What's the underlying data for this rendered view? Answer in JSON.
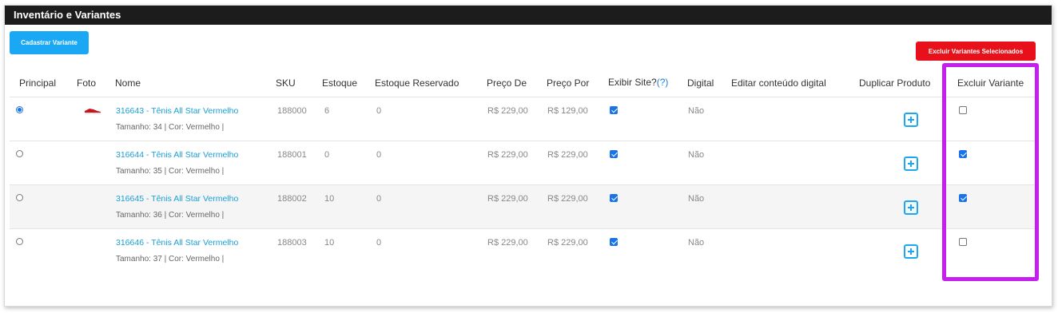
{
  "panel": {
    "title": "Inventário e Variantes"
  },
  "buttons": {
    "add_variant": "Cadastrar Variante",
    "delete_selected": "Excluir Variantes Selecionados"
  },
  "headers": {
    "principal": "Principal",
    "foto": "Foto",
    "nome": "Nome",
    "sku": "SKU",
    "estoque": "Estoque",
    "estoque_reservado": "Estoque Reservado",
    "preco_de": "Preço De",
    "preco_por": "Preço Por",
    "exibir_site": "Exibir Site?",
    "exibir_site_help": "(?)",
    "digital": "Digital",
    "editar_digital": "Editar conteúdo digital",
    "duplicar": "Duplicar Produto",
    "excluir": "Excluir Variante"
  },
  "rows": [
    {
      "principal": true,
      "has_photo": true,
      "name": "316643 - Tênis All Star Vermelho",
      "attrs": "Tamanho: 34 | Cor: Vermelho |",
      "sku": "188000",
      "estoque": "6",
      "reservado": "0",
      "preco_de": "R$ 229,00",
      "preco_por": "R$ 129,00",
      "exibir_site": true,
      "digital": "Não",
      "excluir": false
    },
    {
      "principal": false,
      "has_photo": false,
      "name": "316644 - Tênis All Star Vermelho",
      "attrs": "Tamanho: 35 | Cor: Vermelho |",
      "sku": "188001",
      "estoque": "0",
      "reservado": "0",
      "preco_de": "R$ 229,00",
      "preco_por": "R$ 229,00",
      "exibir_site": true,
      "digital": "Não",
      "excluir": true
    },
    {
      "principal": false,
      "has_photo": false,
      "name": "316645 - Tênis All Star Vermelho",
      "attrs": "Tamanho: 36 | Cor: Vermelho |",
      "sku": "188002",
      "estoque": "10",
      "reservado": "0",
      "preco_de": "R$ 229,00",
      "preco_por": "R$ 229,00",
      "exibir_site": true,
      "digital": "Não",
      "excluir": true
    },
    {
      "principal": false,
      "has_photo": false,
      "name": "316646 - Tênis All Star Vermelho",
      "attrs": "Tamanho: 37 | Cor: Vermelho |",
      "sku": "188003",
      "estoque": "10",
      "reservado": "0",
      "preco_de": "R$ 229,00",
      "preco_por": "R$ 229,00",
      "exibir_site": true,
      "digital": "Não",
      "excluir": false
    }
  ],
  "icons": {
    "duplicate": "plus-square-icon",
    "photo": "shoe-thumbnail"
  },
  "colors": {
    "header_bg": "#1c1c1c",
    "primary_button": "#1aa8f5",
    "danger_button": "#e8101a",
    "link": "#1aa0d8",
    "highlight": "#c71ef0"
  }
}
